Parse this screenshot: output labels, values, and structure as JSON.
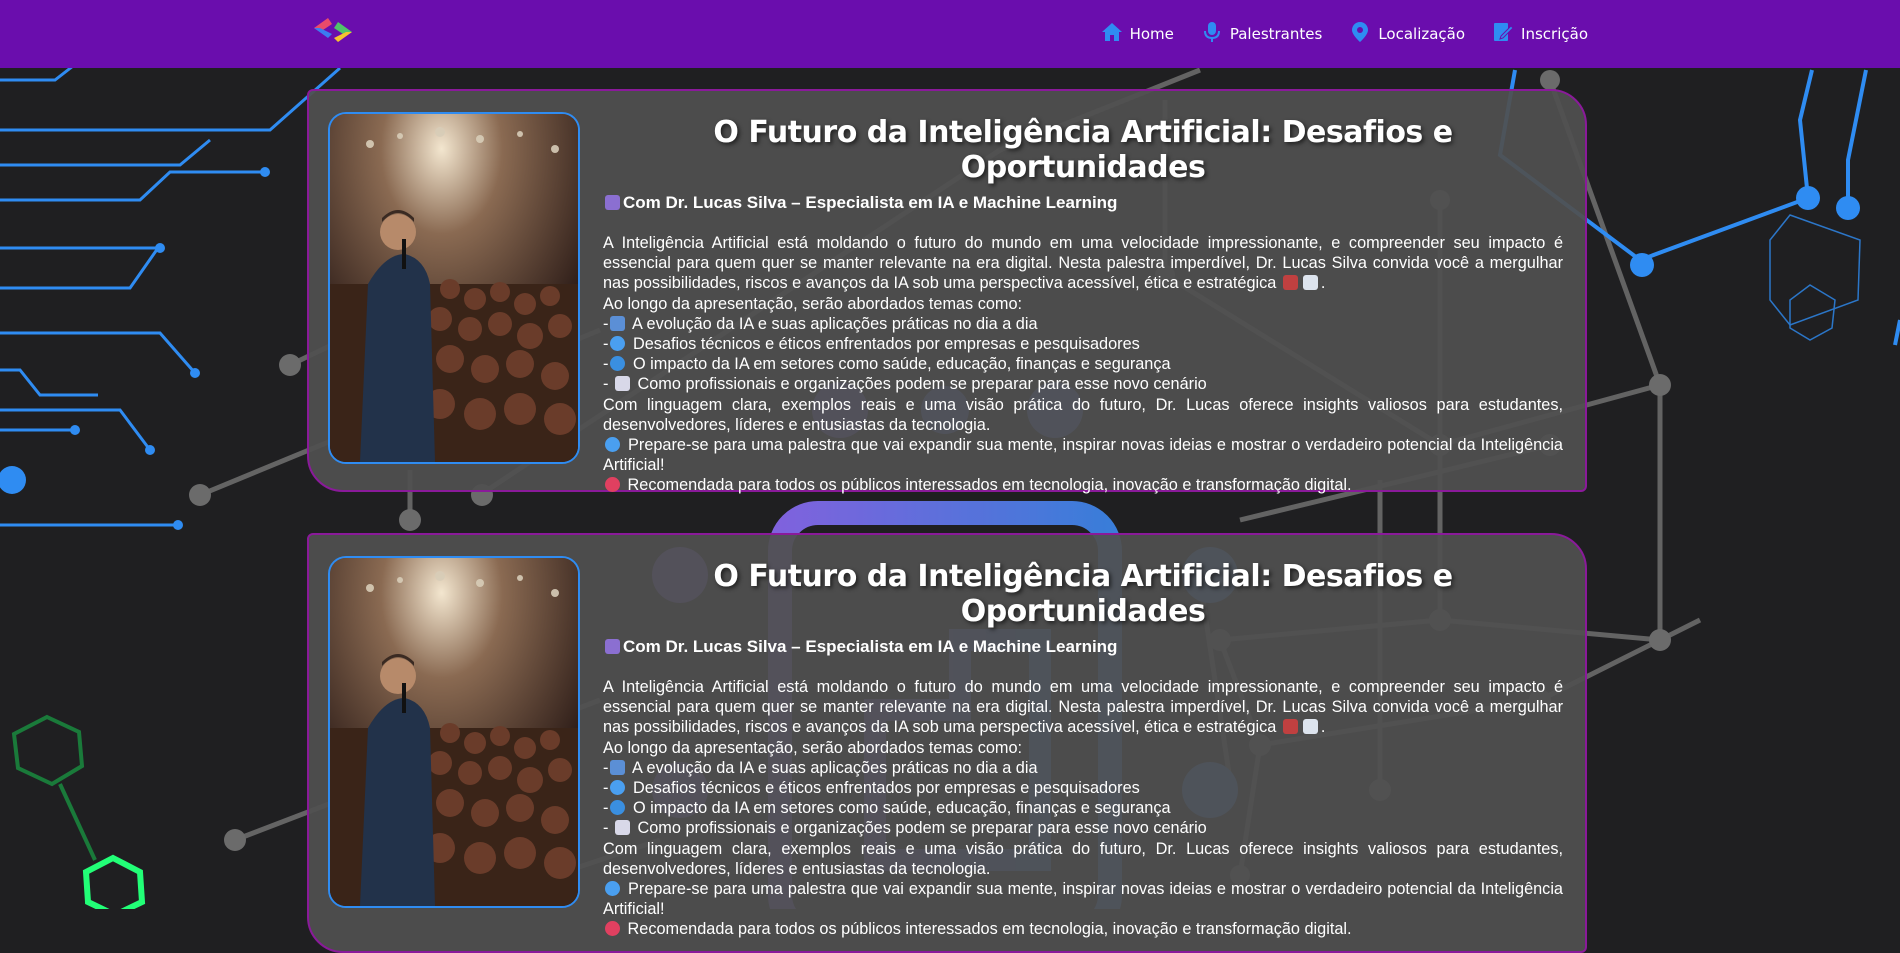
{
  "page": {
    "background_color": "#1f1f21",
    "nav_color": "#6a0dad",
    "card_border_color": "#8a1a9a",
    "accent_blue": "#2f8cf2"
  },
  "navbar": {
    "logo_icon": "code-brackets-logo",
    "items": [
      {
        "label": "Home",
        "icon": "home-icon"
      },
      {
        "label": "Palestrantes",
        "icon": "microphone-icon"
      },
      {
        "label": "Localização",
        "icon": "map-pin-icon"
      },
      {
        "label": "Inscrição",
        "icon": "edit-form-icon"
      }
    ]
  },
  "cards": [
    {
      "title": "O Futuro da Inteligência Artificial: Desafios e Oportunidades",
      "subtitle": "Com Dr. Lucas Silva – Especialista em IA e Machine Learning",
      "intro": "A Inteligência Artificial está moldando o futuro do mundo em uma velocidade impressionante, e compreender seu impacto é essencial para quem quer se manter relevante na era digital. Nesta palestra imperdível, Dr. Lucas Silva convida você a mergulhar nas possibilidades, riscos e avanços da IA sob uma perspectiva acessível, ética e estratégica",
      "topics_intro": "Ao longo da apresentação, serão abordados temas como:",
      "topics": [
        "A evolução da IA e suas aplicações práticas no dia a dia",
        "Desafios técnicos e éticos enfrentados por empresas e pesquisadores",
        "O impacto da IA em setores como saúde, educação, finanças e segurança",
        "Como profissionais e organizações podem se preparar para esse novo cenário"
      ],
      "closing": "Com linguagem clara, exemplos reais e uma visão prática do futuro, Dr. Lucas oferece insights valiosos para estudantes, desenvolvedores, líderes e entusiastas da tecnologia.",
      "cta": "Prepare-se para uma palestra que vai expandir sua mente, inspirar novas ideias e mostrar o verdadeiro potencial da Inteligência Artificial!",
      "audience": "Recomendada para todos os públicos interessados em tecnologia, inovação e transformação digital."
    },
    {
      "title": "O Futuro da Inteligência Artificial: Desafios e Oportunidades",
      "subtitle": "Com Dr. Lucas Silva – Especialista em IA e Machine Learning",
      "intro": "A Inteligência Artificial está moldando o futuro do mundo em uma velocidade impressionante, e compreender seu impacto é essencial para quem quer se manter relevante na era digital. Nesta palestra imperdível, Dr. Lucas Silva convida você a mergulhar nas possibilidades, riscos e avanços da IA sob uma perspectiva acessível, ética e estratégica",
      "topics_intro": "Ao longo da apresentação, serão abordados temas como:",
      "topics": [
        "A evolução da IA e suas aplicações práticas no dia a dia",
        "Desafios técnicos e éticos enfrentados por empresas e pesquisadores",
        "O impacto da IA em setores como saúde, educação, finanças e segurança",
        "Como profissionais e organizações podem se preparar para esse novo cenário"
      ],
      "closing": "Com linguagem clara, exemplos reais e uma visão prática do futuro, Dr. Lucas oferece insights valiosos para estudantes, desenvolvedores, líderes e entusiastas da tecnologia.",
      "cta": "Prepare-se para uma palestra que vai expandir sua mente, inspirar novas ideias e mostrar o verdadeiro potencial da Inteligência Artificial!",
      "audience": "Recomendada para todos os públicos interessados em tecnologia, inovação e transformação digital."
    }
  ]
}
